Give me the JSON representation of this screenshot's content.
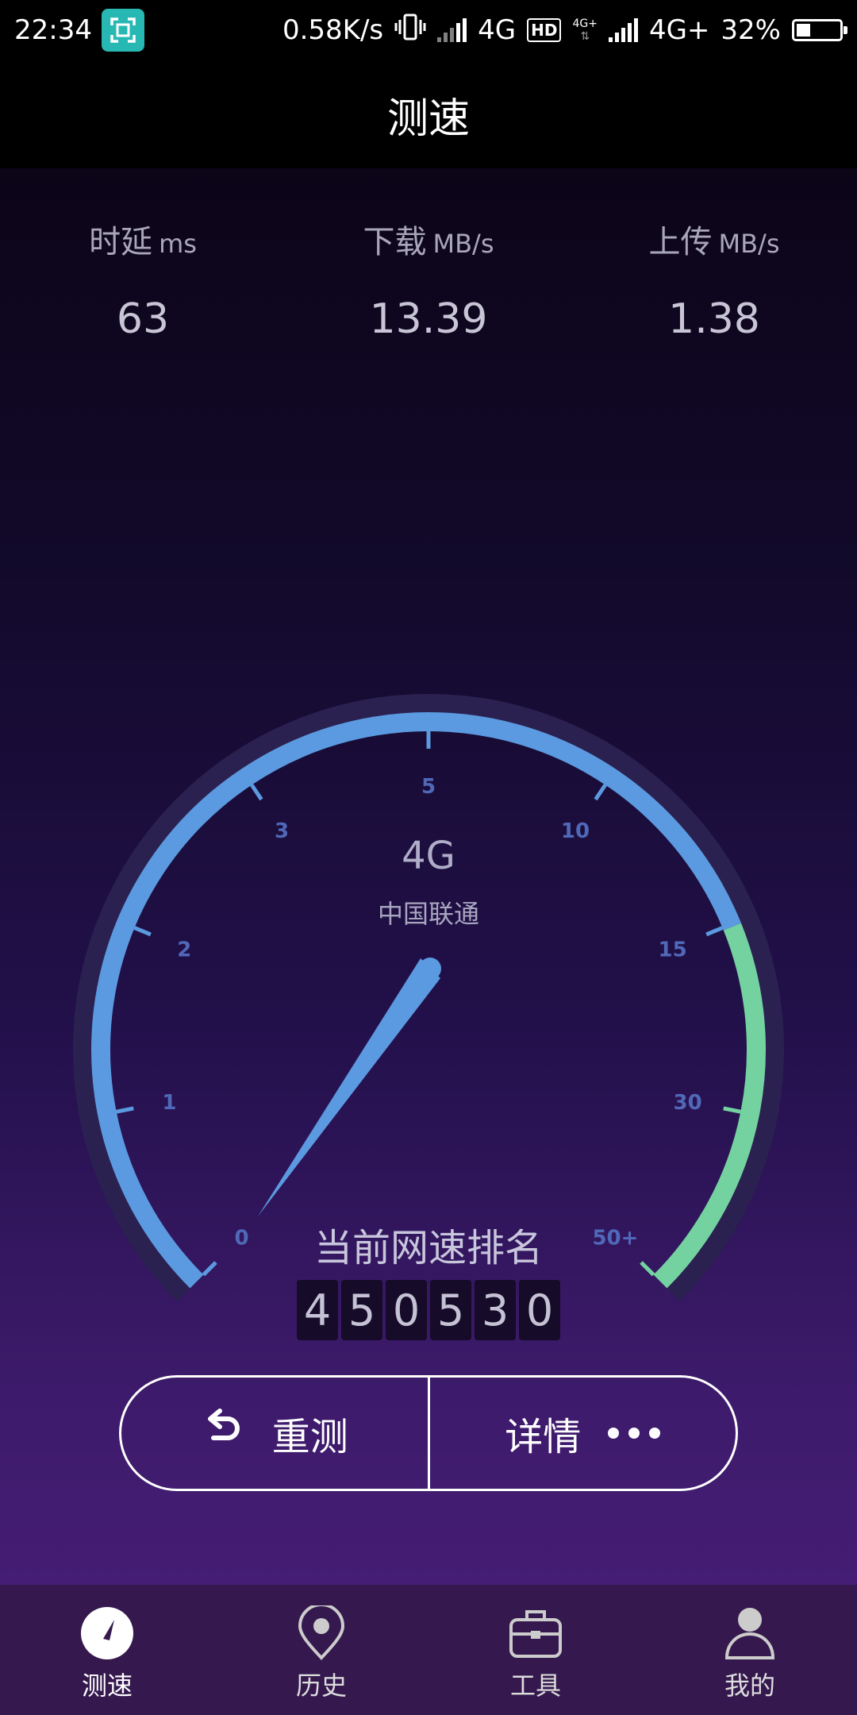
{
  "status_bar": {
    "time": "22:34",
    "net_speed": "0.58K/s",
    "network1": "4G",
    "hd": "HD",
    "small_badge": "4G+",
    "network2": "4G+",
    "battery": "32%",
    "battery_level": 0.32
  },
  "title": "测速",
  "metrics": [
    {
      "label": "时延",
      "unit": "ms",
      "value": "63"
    },
    {
      "label": "下载",
      "unit": "MB/s",
      "value": "13.39"
    },
    {
      "label": "上传",
      "unit": "MB/s",
      "value": "1.38"
    }
  ],
  "gauge": {
    "network": "4G",
    "carrier": "中国联通",
    "ticks": [
      "0",
      "1",
      "2",
      "3",
      "5",
      "10",
      "15",
      "30",
      "50+"
    ],
    "needle_value": 0,
    "colors": {
      "arc_blue": "#5b9ae0",
      "arc_green": "#74d2a0",
      "track": "#2a2150"
    }
  },
  "rank": {
    "title": "当前网速排名",
    "digits": [
      "4",
      "5",
      "0",
      "5",
      "3",
      "0"
    ]
  },
  "buttons": {
    "retest": "重测",
    "details": "详情"
  },
  "tabs": [
    {
      "label": "测速",
      "icon": "speedometer-icon"
    },
    {
      "label": "历史",
      "icon": "location-pin-icon"
    },
    {
      "label": "工具",
      "icon": "toolbox-icon"
    },
    {
      "label": "我的",
      "icon": "user-icon"
    }
  ]
}
